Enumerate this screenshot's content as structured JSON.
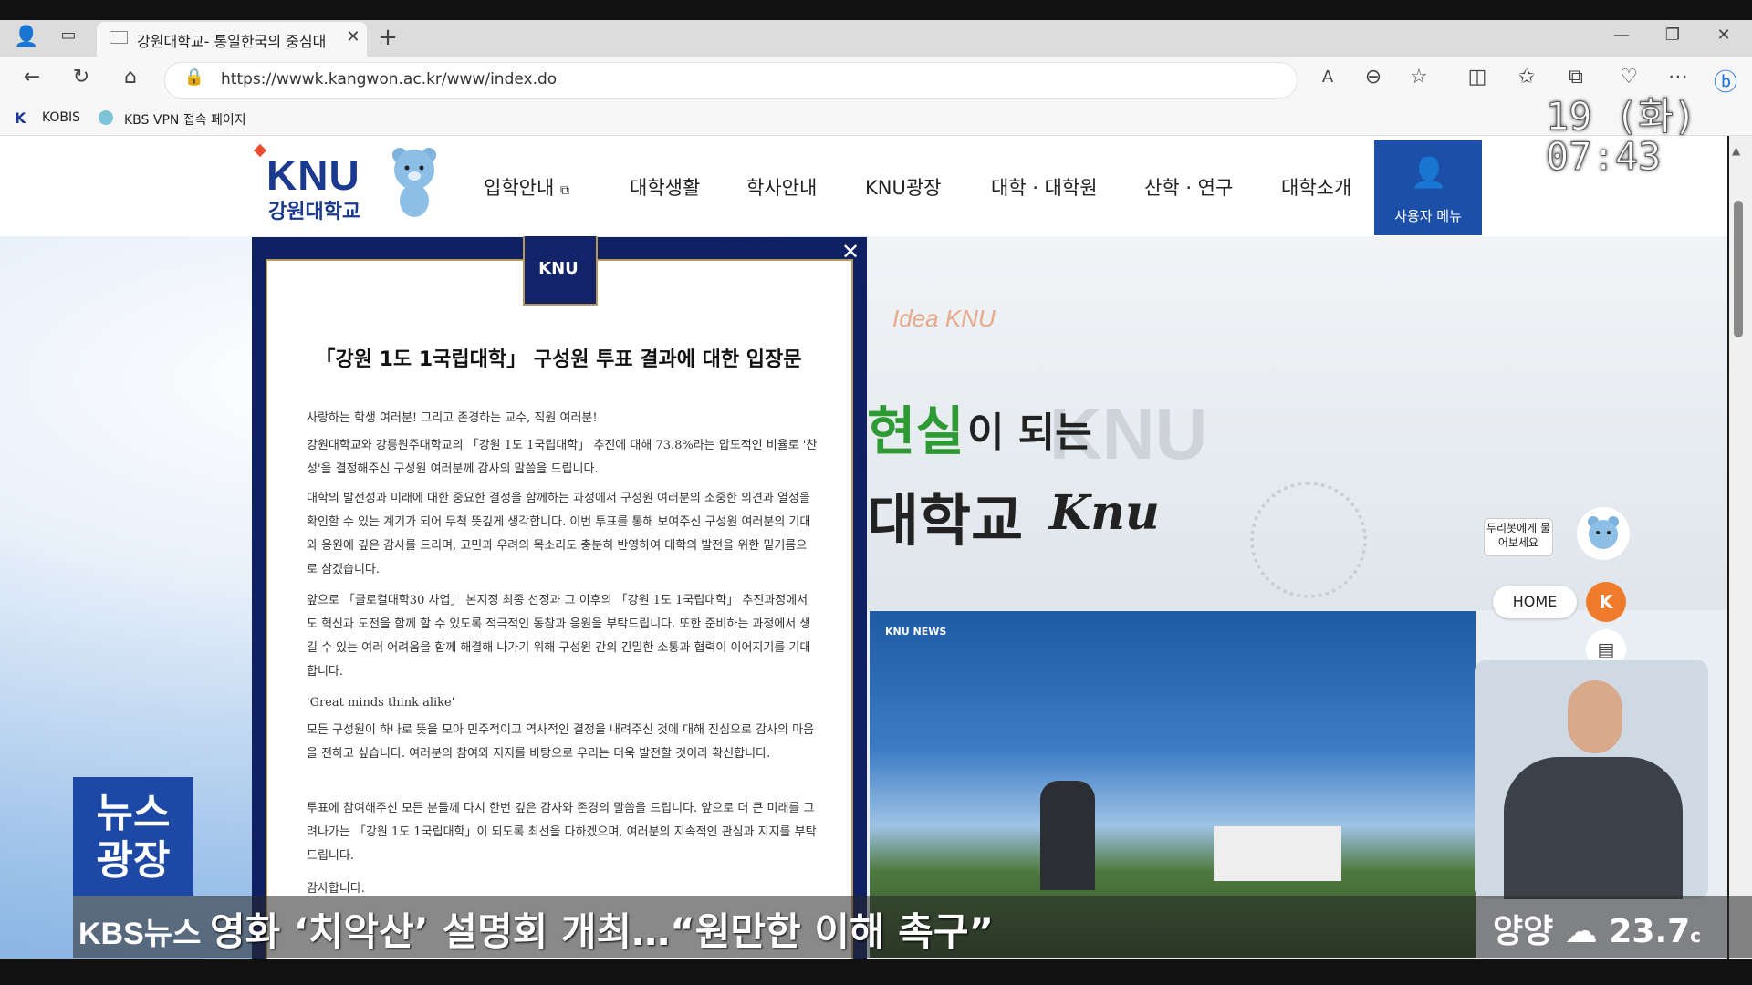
{
  "browser": {
    "tab_title": "강원대학교- 통일한국의 중심대",
    "url": "https://wwwk.kangwon.ac.kr/www/index.do",
    "favorites": [
      "KOBIS",
      "KBS VPN 접속 페이지"
    ]
  },
  "site": {
    "logo_text": "KNU",
    "logo_sub": "강원대학교",
    "nav": [
      "입학안내",
      "대학생활",
      "학사안내",
      "KNU광장",
      "대학 · 대학원",
      "산학 · 연구",
      "대학소개"
    ],
    "user_menu_label": "사용자 메뉴",
    "slogan_en": "Idea KNU",
    "slogan_big": "KNU",
    "slogan_green": "현실",
    "slogan_dark": "이 되는",
    "slogan_dark2": "대학교",
    "slogan_script": "Knu",
    "bot_label": "두리봇에게 물어보세요",
    "home_label": "HOME",
    "news_logo": "KNU NEWS"
  },
  "popup": {
    "emblem": "KNU",
    "title": "「강원 1도 1국립대학」 구성원 투표 결과에 대한 입장문",
    "paragraphs": [
      "사랑하는 학생 여러분! 그리고 존경하는 교수, 직원 여러분!",
      "강원대학교와 강릉원주대학교의 「강원 1도 1국립대학」 추진에 대해 73.8%라는 압도적인 비율로 '찬성'을 결정해주신 구성원 여러분께 감사의 말씀을 드립니다.",
      "대학의 발전성과 미래에 대한 중요한 결정을 함께하는 과정에서 구성원 여러분의 소중한 의견과 열정을 확인할 수 있는 계기가 되어 무척 뜻깊게 생각합니다. 이번 투표를 통해 보여주신 구성원 여러분의 기대와 응원에 깊은 감사를 드리며, 고민과 우려의 목소리도 충분히 반영하여 대학의 발전을 위한 밑거름으로 삼겠습니다.",
      "앞으로 「글로컬대학30 사업」 본지정 최종 선정과 그 이후의 「강원 1도 1국립대학」 추진과정에서도 혁신과 도전을 함께 할 수 있도록 적극적인 동참과 응원을 부탁드립니다. 또한 준비하는 과정에서 생길 수 있는 여러 어려움을 함께 해결해 나가기 위해 구성원 간의 긴밀한 소통과 협력이 이어지기를 기대합니다.",
      "'Great minds think alike'",
      "모든 구성원이 하나로 뜻을 모아 민주적이고 역사적인 결정을 내려주신 것에 대해 진심으로 감사의 마음을 전하고 싶습니다. 여러분의 참여와 지지를 바탕으로 우리는 더욱 발전할 것이라 확신합니다.",
      "투표에 참여해주신 모든 분들께 다시 한번 깊은 감사와 존경의 말씀을 드립니다. 앞으로 더 큰 미래를 그려나가는 「강원 1도 1국립대학」이 되도록 최선을 다하겠으며, 여러분의 지속적인 관심과 지지를 부탁드립니다.",
      "감사합니다."
    ]
  },
  "broadcast": {
    "date": "19 (화)",
    "time": "07:43",
    "program_logo": "뉴스 광장",
    "brand": "KBS뉴스",
    "headline": "영화 ‘치악산’ 설명회 개최…“원만한 이해 촉구”",
    "weather_city": "양양",
    "weather_temp": "23.7",
    "weather_unit": "c"
  },
  "colors": {
    "brand_blue": "#1b3a8f",
    "user_menu_bg": "#1c4fa8",
    "popup_navy": "#0f2063",
    "home_orange": "#f07c2b",
    "kbs_blue": "#1e48a6"
  }
}
